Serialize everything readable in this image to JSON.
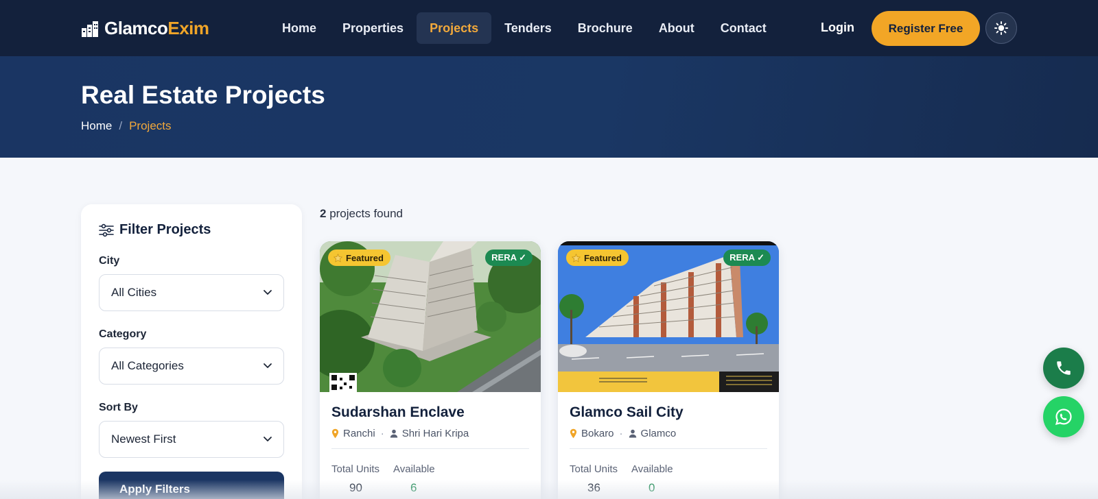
{
  "brand": {
    "name_part1": "Glamco",
    "name_part2": "Exim",
    "accent": "#f0a528",
    "navy": "#13213c"
  },
  "nav": {
    "items": [
      {
        "label": "Home"
      },
      {
        "label": "Properties"
      },
      {
        "label": "Projects",
        "active": true
      },
      {
        "label": "Tenders"
      },
      {
        "label": "Brochure"
      },
      {
        "label": "About"
      },
      {
        "label": "Contact"
      }
    ],
    "login_label": "Login",
    "register_label": "Register Free",
    "theme_icon": "sun-icon"
  },
  "hero": {
    "title": "Real Estate Projects",
    "breadcrumb": {
      "home": "Home",
      "separator": "/",
      "current": "Projects"
    }
  },
  "filters": {
    "title": "Filter Projects",
    "city": {
      "label": "City",
      "value": "All Cities"
    },
    "category": {
      "label": "Category",
      "value": "All Categories"
    },
    "sort": {
      "label": "Sort By",
      "value": "Newest First"
    },
    "apply_label": "Apply Filters"
  },
  "results": {
    "count": "2",
    "count_suffix": " projects found",
    "projects": [
      {
        "featured_label": "Featured",
        "rera_label": "RERA ✓",
        "title": "Sudarshan Enclave",
        "city": "Ranchi",
        "developer": "Shri Hari Kripa",
        "total_units_label": "Total Units",
        "total_units": "90",
        "available_label": "Available",
        "available": "6"
      },
      {
        "featured_label": "Featured",
        "rera_label": "RERA ✓",
        "title": "Glamco Sail City",
        "city": "Bokaro",
        "developer": "Glamco",
        "total_units_label": "Total Units",
        "total_units": "36",
        "available_label": "Available",
        "available": "0"
      }
    ]
  },
  "floating": {
    "phone_icon": "phone-icon",
    "whatsapp_icon": "whatsapp-icon"
  }
}
